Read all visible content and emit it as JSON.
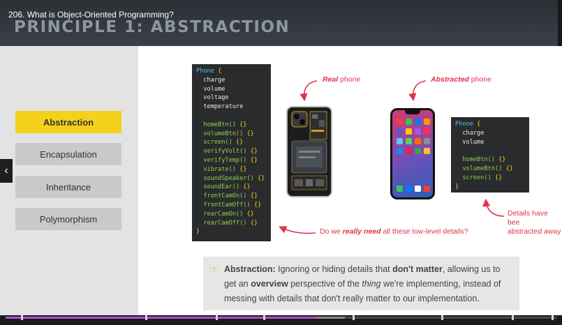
{
  "video": {
    "title": "206. What is Object-Oriented Programming?",
    "progress_percent": 56.5
  },
  "slide": {
    "heading": "PRINCIPLE 1: ABSTRACTION",
    "accent_color": "#f4d21b",
    "nav_items": [
      {
        "label": "Abstraction",
        "active": true
      },
      {
        "label": "Encapsulation",
        "active": false
      },
      {
        "label": "Inheritance",
        "active": false
      },
      {
        "label": "Polymorphism",
        "active": false
      }
    ],
    "code_full": {
      "header_keyword": "Phone",
      "header_brace": "{",
      "properties": [
        "charge",
        "volume",
        "voltage",
        "temperature"
      ],
      "methods": [
        "homeBtn()",
        "volumeBtn()",
        "screen()",
        "verifyVolt()",
        "verifyTemp()",
        "vibrate()",
        "soundSpeaker()",
        "soundEar()",
        "frontCamOn()",
        "frontCamOff()",
        "rearCamOn()",
        "rearCamOff()"
      ],
      "method_body": "{}",
      "closing": "}"
    },
    "code_abstracted": {
      "header_keyword": "Phone",
      "header_brace": "{",
      "properties": [
        "charge",
        "volume"
      ],
      "methods": [
        "homeBtn()",
        "volumeBtn()",
        "screen()"
      ],
      "method_body": "{}",
      "closing": "}"
    },
    "callouts": {
      "real_phone_em": "Real",
      "real_phone_rest": " phone",
      "abstracted_em": "Abstracted",
      "abstracted_rest": " phone",
      "details_line1": "Details have bee",
      "details_line2": "abstracted away",
      "question_pre": "Do we ",
      "question_em": "really need",
      "question_post": " all these low-level details?"
    },
    "note": {
      "label": "Abstraction:",
      "t1": " Ignoring or hiding details that ",
      "b1": "don't matter",
      "t2": ", allowing us to get an ",
      "b2": "overview",
      "t3": " perspective of the ",
      "i1": "thing",
      "t4": " we're implementing, instead of messing with details that don't really matter to our implementation."
    }
  }
}
